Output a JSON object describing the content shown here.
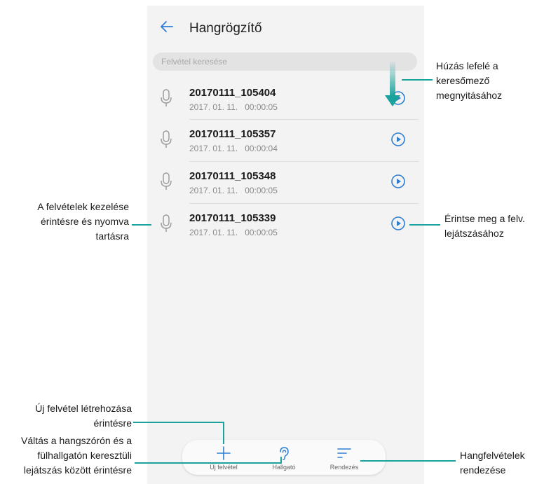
{
  "app": {
    "title": "Hangrögzítő"
  },
  "search": {
    "placeholder": "Felvétel keresése"
  },
  "recordings": [
    {
      "name": "20170111_105404",
      "date": "2017. 01. 11.",
      "duration": "00:00:05"
    },
    {
      "name": "20170111_105357",
      "date": "2017. 01. 11.",
      "duration": "00:00:04"
    },
    {
      "name": "20170111_105348",
      "date": "2017. 01. 11.",
      "duration": "00:00:05"
    },
    {
      "name": "20170111_105339",
      "date": "2017. 01. 11.",
      "duration": "00:00:05"
    }
  ],
  "bottom_bar": {
    "new_label": "Új felvétel",
    "earpiece_label": "Hallgató",
    "sort_label": "Rendezés"
  },
  "annotations": {
    "pull_down": [
      "Húzás lefelé a",
      "keresőmező",
      "megnyitásához"
    ],
    "manage": [
      "A felvételek kezelése",
      "érintésre és nyomva",
      "tartásra"
    ],
    "play": [
      "Érintse meg a felv.",
      "lejátszásához"
    ],
    "new_recording": [
      "Új felvétel létrehozása",
      "érintésre"
    ],
    "switch_output": [
      "Váltás a hangszórón és a",
      "fülhallgatón keresztüli",
      "lejátszás között érintésre"
    ],
    "sort": [
      "Hangfelvételek",
      "rendezése"
    ]
  },
  "colors": {
    "accent": "#2f7fd1",
    "leader": "#1aa39c",
    "icon_gray": "#9a9a9a"
  },
  "icons": [
    "back-arrow-icon",
    "microphone-icon",
    "play-icon",
    "plus-icon",
    "ear-icon",
    "sort-icon",
    "pull-down-arrow-icon"
  ]
}
